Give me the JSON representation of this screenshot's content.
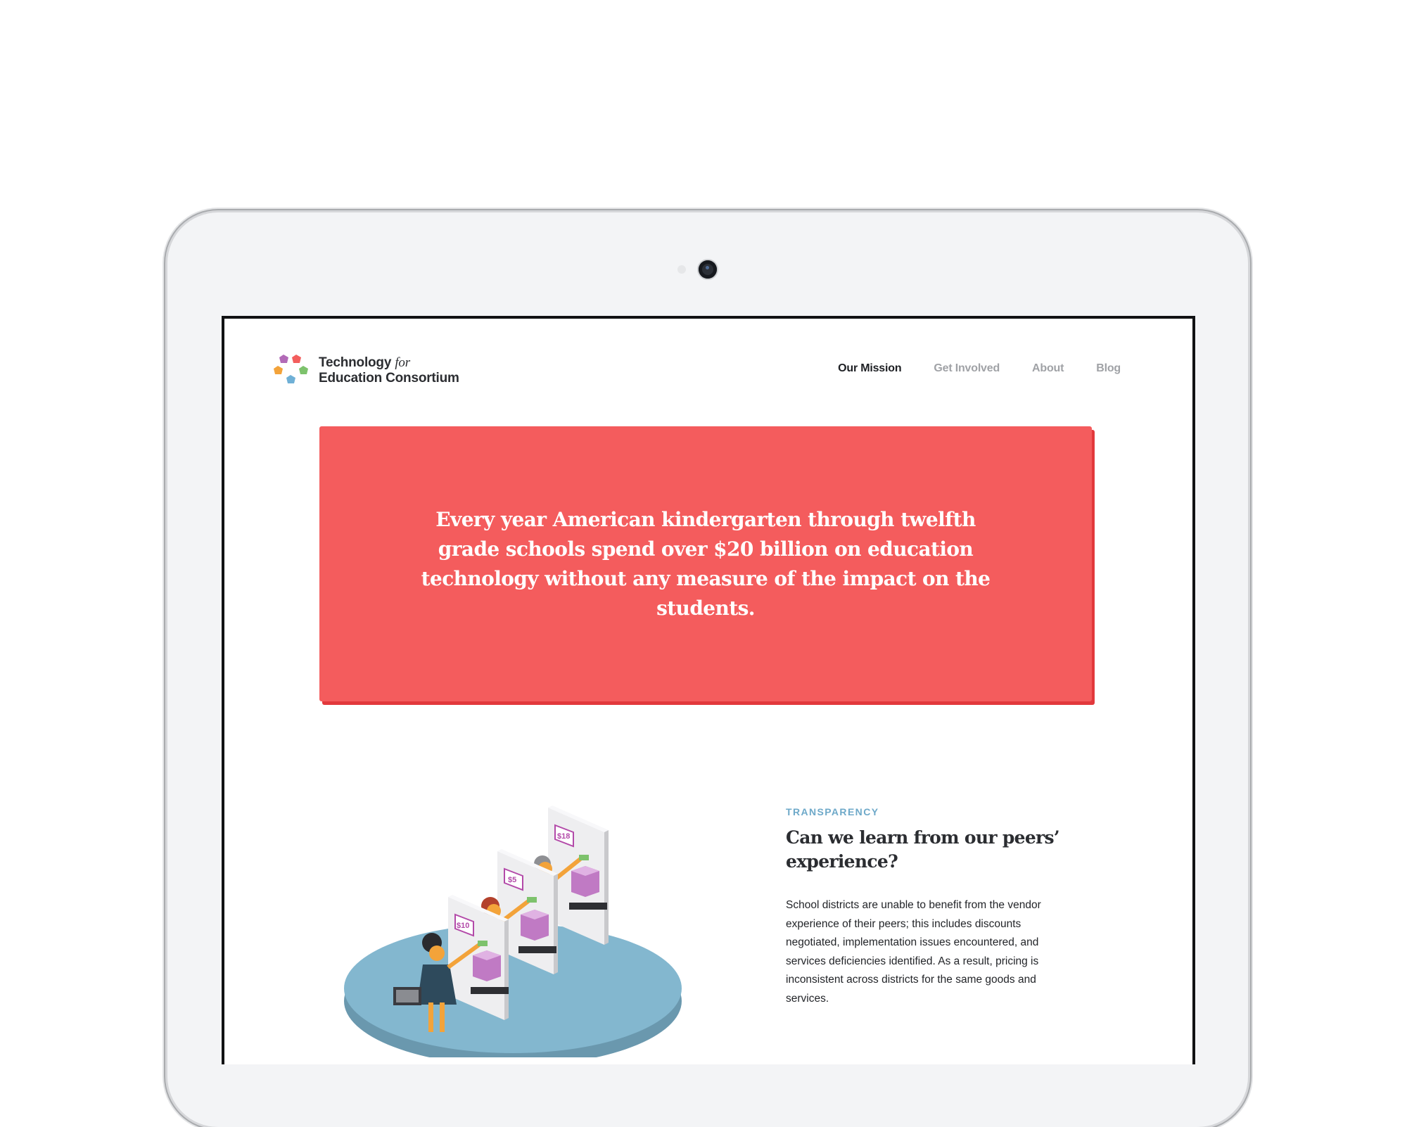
{
  "brand": {
    "name_line1": "Technology",
    "name_for": "for",
    "name_line2": "Education Consortium",
    "logo_colors": [
      "#b26ab7",
      "#f35e5d",
      "#f3a33a",
      "#7dc26c",
      "#6fb0d6"
    ]
  },
  "nav": {
    "items": [
      {
        "label": "Our Mission",
        "active": true
      },
      {
        "label": "Get Involved",
        "active": false
      },
      {
        "label": "About",
        "active": false
      },
      {
        "label": "Blog",
        "active": false
      }
    ]
  },
  "hero": {
    "text": "Every year American kindergarten through twelfth grade schools spend over $20 billion on education technology without any measure of the impact on the students.",
    "color": "#f45c5d"
  },
  "feature": {
    "eyebrow": "TRANSPARENCY",
    "title": "Can we learn from our peers’ experience?",
    "body": "School districts are unable to benefit from the vendor experience of their peers; this includes discounts negotiated, implementation issues encountered, and services deficiencies identified. As a result, pricing is inconsistent across districts for the same goods and services.",
    "accent": "#6ea9c9"
  },
  "illustration": {
    "price_tags": [
      "$10",
      "$5",
      "$18"
    ]
  }
}
